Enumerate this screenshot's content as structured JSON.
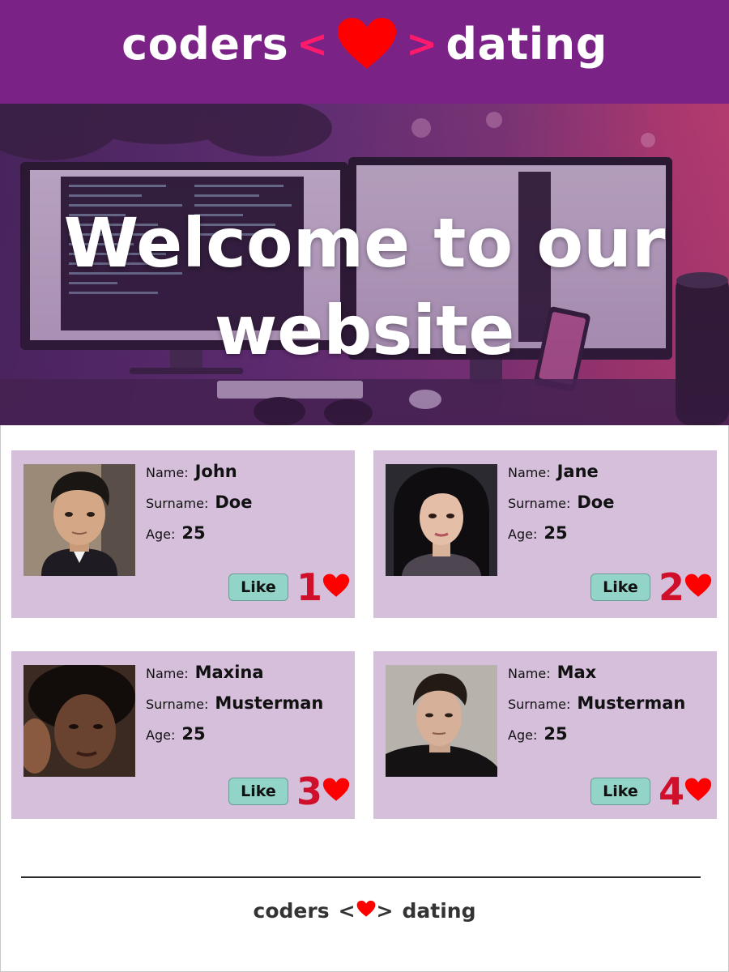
{
  "header": {
    "brand_left": "coders",
    "bracket_open": "<",
    "bracket_close": ">",
    "brand_right": "dating",
    "heart_icon": "heart-icon",
    "color": "#7b2286"
  },
  "hero": {
    "title_line1": "Welcome to our",
    "title_line2": "website"
  },
  "profiles": [
    {
      "name_label": "Name:",
      "name": "John",
      "surname_label": "Surname:",
      "surname": "Doe",
      "age_label": "Age:",
      "age": "25",
      "like_label": "Like",
      "likes": "1"
    },
    {
      "name_label": "Name:",
      "name": "Jane",
      "surname_label": "Surname:",
      "surname": "Doe",
      "age_label": "Age:",
      "age": "25",
      "like_label": "Like",
      "likes": "2"
    },
    {
      "name_label": "Name:",
      "name": "Maxina",
      "surname_label": "Surname:",
      "surname": "Musterman",
      "age_label": "Age:",
      "age": "25",
      "like_label": "Like",
      "likes": "3"
    },
    {
      "name_label": "Name:",
      "name": "Max",
      "surname_label": "Surname:",
      "surname": "Musterman",
      "age_label": "Age:",
      "age": "25",
      "like_label": "Like",
      "likes": "4"
    }
  ],
  "footer": {
    "brand_left": "coders",
    "bracket_open": "<",
    "bracket_close": ">",
    "brand_right": "dating"
  },
  "colors": {
    "card_bg": "#d5bfdb",
    "like_button": "#93d4c8",
    "like_count": "#d0102a",
    "heart": "#ff0000"
  }
}
